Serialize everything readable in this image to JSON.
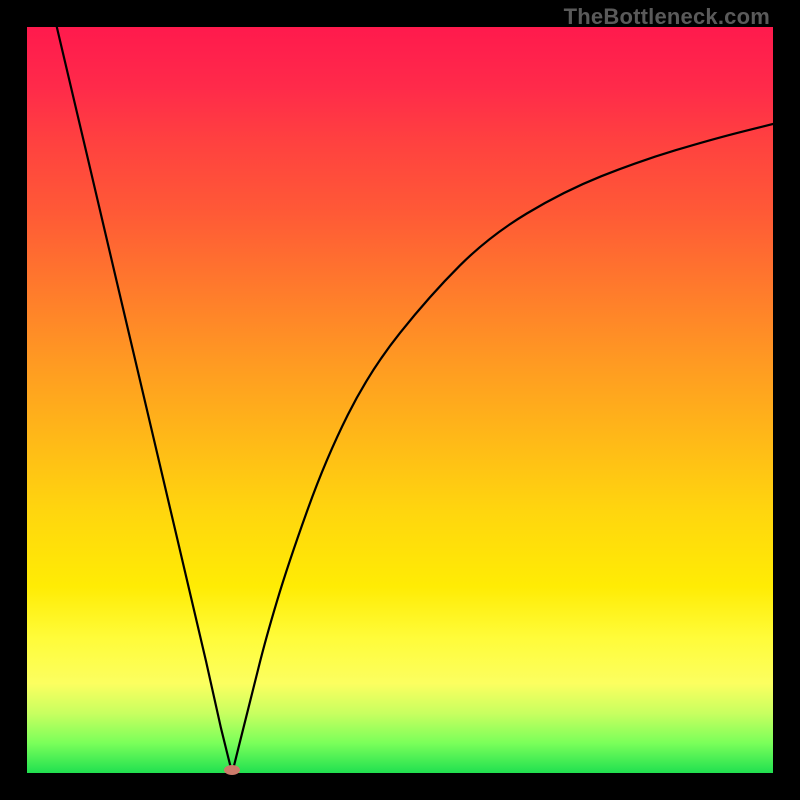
{
  "watermark": "TheBottleneck.com",
  "chart_data": {
    "type": "line",
    "title": "",
    "xlabel": "",
    "ylabel": "",
    "xlim": [
      0,
      100
    ],
    "ylim": [
      0,
      100
    ],
    "series": [
      {
        "name": "left-branch",
        "x": [
          4,
          8,
          12,
          16,
          20,
          24,
          26,
          27,
          27.5
        ],
        "y": [
          100,
          83,
          66,
          49,
          32,
          15,
          6,
          2,
          0
        ]
      },
      {
        "name": "right-branch",
        "x": [
          27.5,
          28,
          29,
          30,
          32,
          35,
          40,
          46,
          54,
          62,
          72,
          82,
          92,
          100
        ],
        "y": [
          0,
          2,
          6,
          10,
          18,
          28,
          42,
          54,
          64,
          72,
          78,
          82,
          85,
          87
        ]
      }
    ],
    "minimum_point": {
      "x": 27.5,
      "y": 0
    },
    "marker": {
      "x": 27.5,
      "y": 0,
      "color": "#cc7a6a"
    },
    "gradient_stops": [
      {
        "pos": 0,
        "color": "#ff1a4d"
      },
      {
        "pos": 50,
        "color": "#ffb018"
      },
      {
        "pos": 85,
        "color": "#fffc3a"
      },
      {
        "pos": 100,
        "color": "#20e050"
      }
    ]
  }
}
